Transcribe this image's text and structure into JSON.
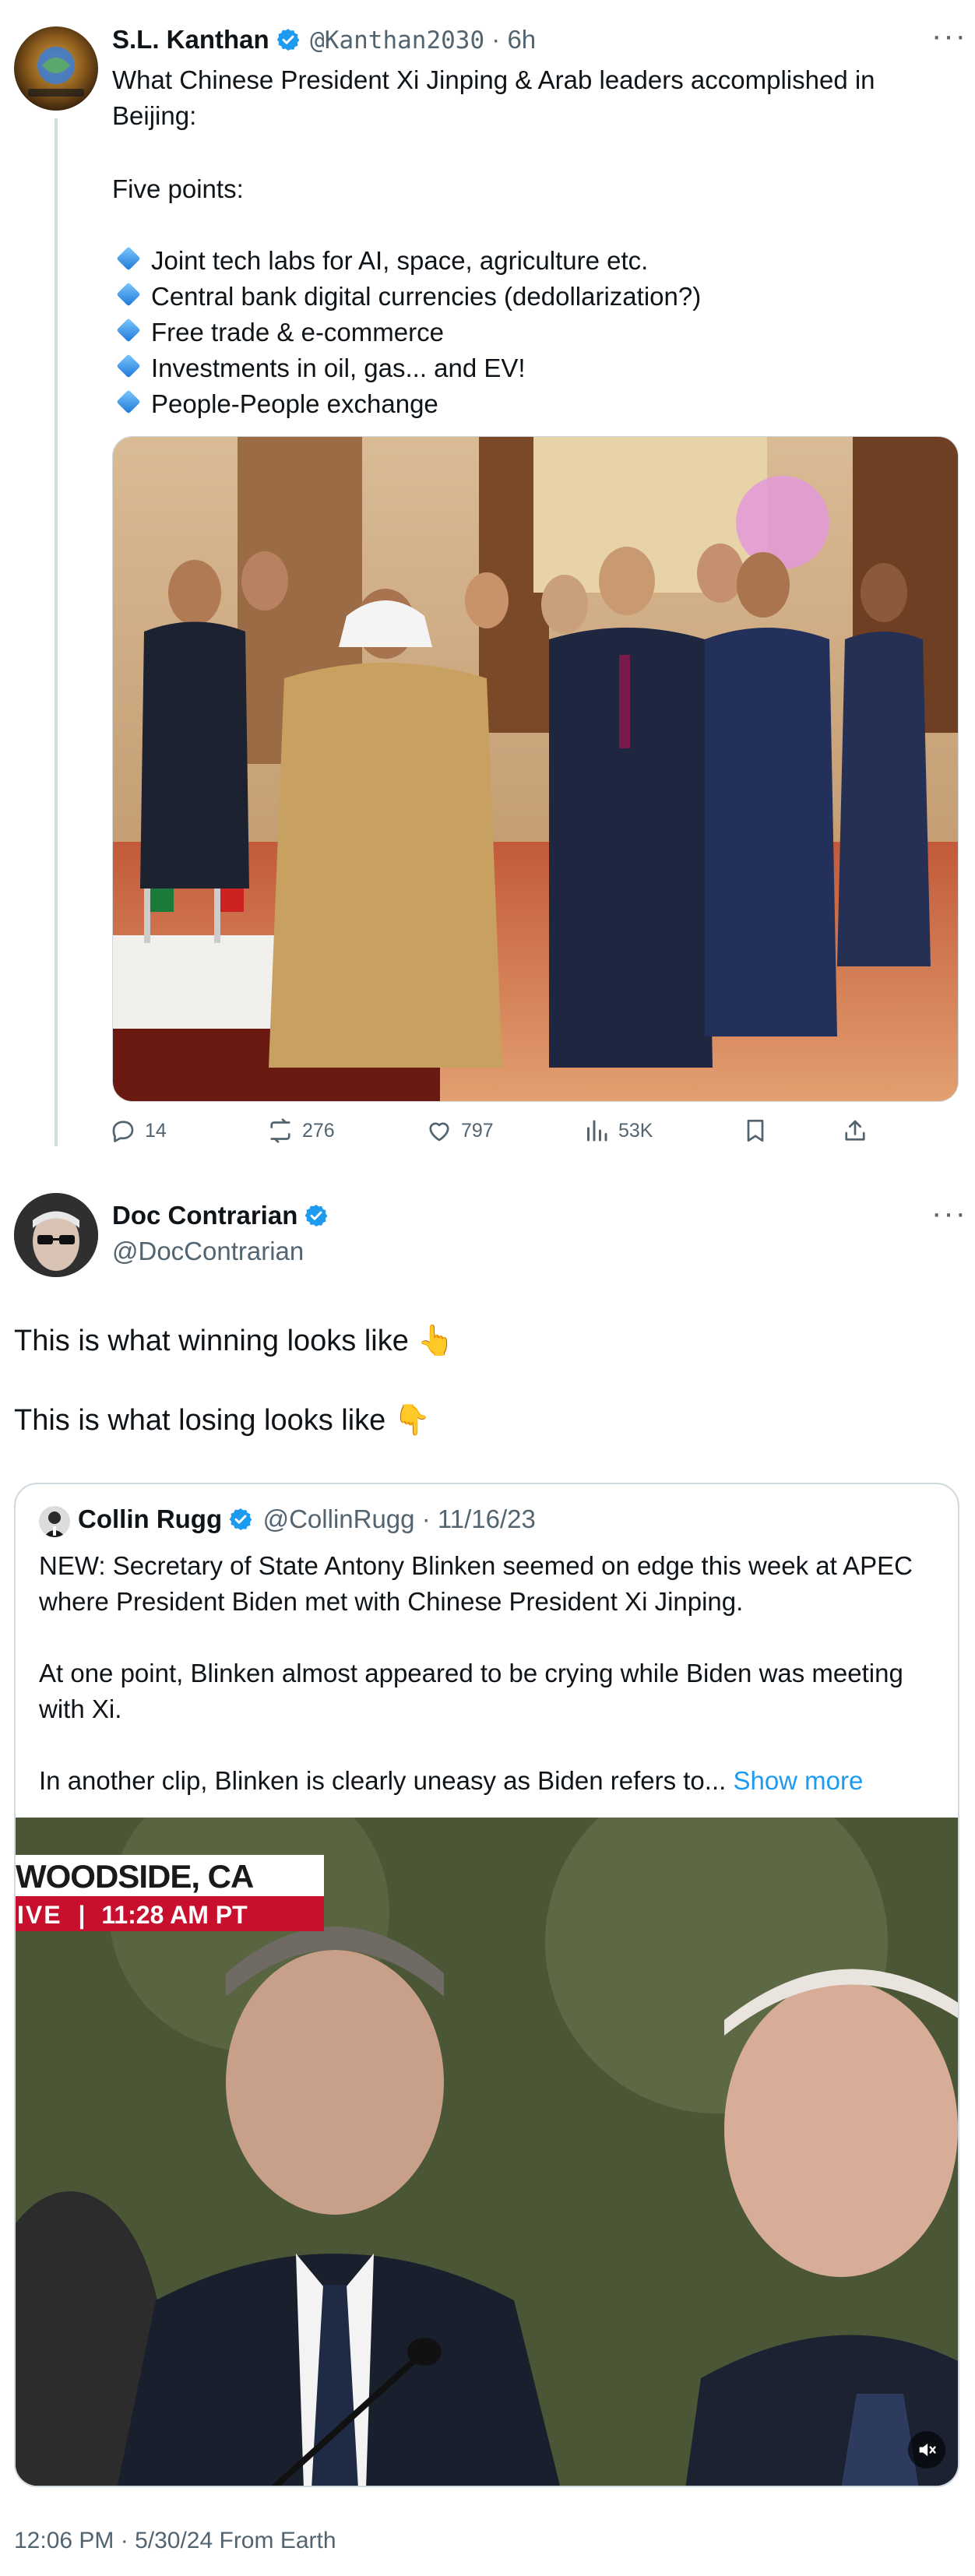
{
  "tweet1": {
    "name": "S.L. Kanthan",
    "handle": "@Kanthan2030",
    "time": "6h",
    "intro": "What Chinese President Xi Jinping & Arab leaders accomplished in Beijing:",
    "points_heading": "Five points:",
    "points": [
      "Joint tech labs for AI, space, agriculture etc.",
      "Central bank digital currencies (dedollarization?)",
      "Free trade & e-commerce",
      "Investments in oil, gas... and EV!",
      "People-People exchange"
    ],
    "actions": {
      "replies": "14",
      "reposts": "276",
      "likes": "797",
      "views": "53K"
    }
  },
  "tweet2": {
    "name": "Doc Contrarian",
    "handle": "@DocContrarian",
    "line1": "This is what winning looks like",
    "line1_emoji": "👆",
    "line2": "This is what losing looks like",
    "line2_emoji": "👇",
    "footer": "12:06 PM · 5/30/24 From Earth"
  },
  "quote": {
    "name": "Collin Rugg",
    "handle": "@CollinRugg",
    "date": "11/16/23",
    "p1": "NEW: Secretary of State Antony Blinken seemed on edge this week at APEC where President Biden met with Chinese President Xi Jinping.",
    "p2": "At one point, Blinken almost appeared to be crying while Biden was meeting with Xi.",
    "p3": "In another clip, Blinken is clearly uneasy as Biden refers to...",
    "show_more": "Show more",
    "video_location": "WOODSIDE, CA",
    "video_live": "IVE",
    "video_time": "11:28 AM PT"
  },
  "colors": {
    "accent": "#1d9bf0",
    "secondary_text": "#536471",
    "border": "#cfd9de"
  }
}
